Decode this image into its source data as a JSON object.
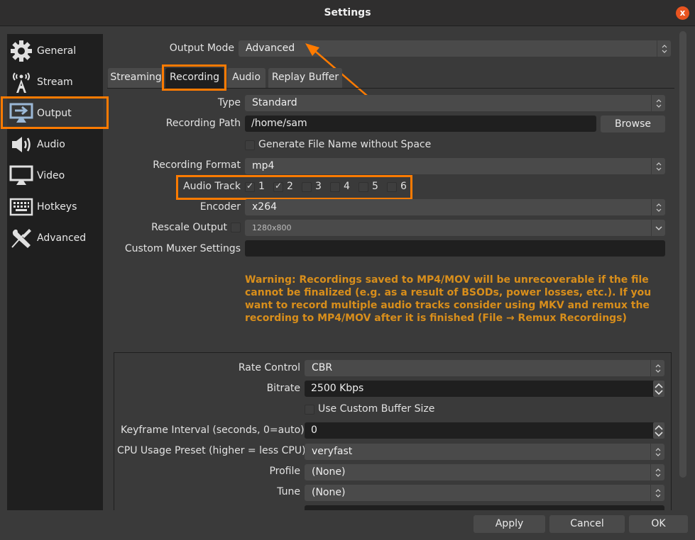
{
  "window": {
    "title": "Settings",
    "close_label": "x"
  },
  "sidebar": {
    "items": [
      {
        "label": "General",
        "icon": "gear-icon"
      },
      {
        "label": "Stream",
        "icon": "broadcast-tower-icon"
      },
      {
        "label": "Output",
        "icon": "monitor-arrow-icon",
        "active": true
      },
      {
        "label": "Audio",
        "icon": "speaker-icon"
      },
      {
        "label": "Video",
        "icon": "monitor-icon"
      },
      {
        "label": "Hotkeys",
        "icon": "keyboard-icon"
      },
      {
        "label": "Advanced",
        "icon": "tools-icon"
      }
    ]
  },
  "output_mode": {
    "label": "Output Mode",
    "value": "Advanced"
  },
  "tabs": [
    {
      "label": "Streaming"
    },
    {
      "label": "Recording",
      "active": true
    },
    {
      "label": "Audio"
    },
    {
      "label": "Replay Buffer"
    }
  ],
  "recording": {
    "type": {
      "label": "Type",
      "value": "Standard"
    },
    "path": {
      "label": "Recording Path",
      "value": "/home/sam",
      "browse_label": "Browse"
    },
    "gen_filename": {
      "label": "Generate File Name without Space",
      "checked": false
    },
    "format": {
      "label": "Recording Format",
      "value": "mp4"
    },
    "audio_track": {
      "label": "Audio Track",
      "tracks": [
        {
          "label": "1",
          "checked": true
        },
        {
          "label": "2",
          "checked": true
        },
        {
          "label": "3",
          "checked": false
        },
        {
          "label": "4",
          "checked": false
        },
        {
          "label": "5",
          "checked": false
        },
        {
          "label": "6",
          "checked": false
        }
      ]
    },
    "encoder": {
      "label": "Encoder",
      "value": "x264"
    },
    "rescale": {
      "label": "Rescale Output",
      "checked": false,
      "value": "1280x800"
    },
    "muxer": {
      "label": "Custom Muxer Settings",
      "value": ""
    },
    "warning": "Warning: Recordings saved to MP4/MOV will be unrecoverable if the file cannot be finalized (e.g. as a result of BSODs, power losses, etc.). If you want to record multiple audio tracks consider using MKV and remux the recording to MP4/MOV after it is finished (File → Remux Recordings)"
  },
  "encoder_settings": {
    "rate_control": {
      "label": "Rate Control",
      "value": "CBR"
    },
    "bitrate": {
      "label": "Bitrate",
      "value": "2500 Kbps"
    },
    "custom_buffer": {
      "label": "Use Custom Buffer Size",
      "checked": false
    },
    "keyframe": {
      "label": "Keyframe Interval (seconds, 0=auto)",
      "value": "0"
    },
    "cpu_preset": {
      "label": "CPU Usage Preset (higher = less CPU)",
      "value": "veryfast"
    },
    "profile": {
      "label": "Profile",
      "value": "(None)"
    },
    "tune": {
      "label": "Tune",
      "value": "(None)"
    },
    "x264_options": {
      "value": ""
    }
  },
  "footer": {
    "apply_label": "Apply",
    "cancel_label": "Cancel",
    "ok_label": "OK"
  },
  "colors": {
    "accent_highlight": "#ff7b00",
    "warning_text": "#d88e1b",
    "close_button": "#e95420"
  }
}
